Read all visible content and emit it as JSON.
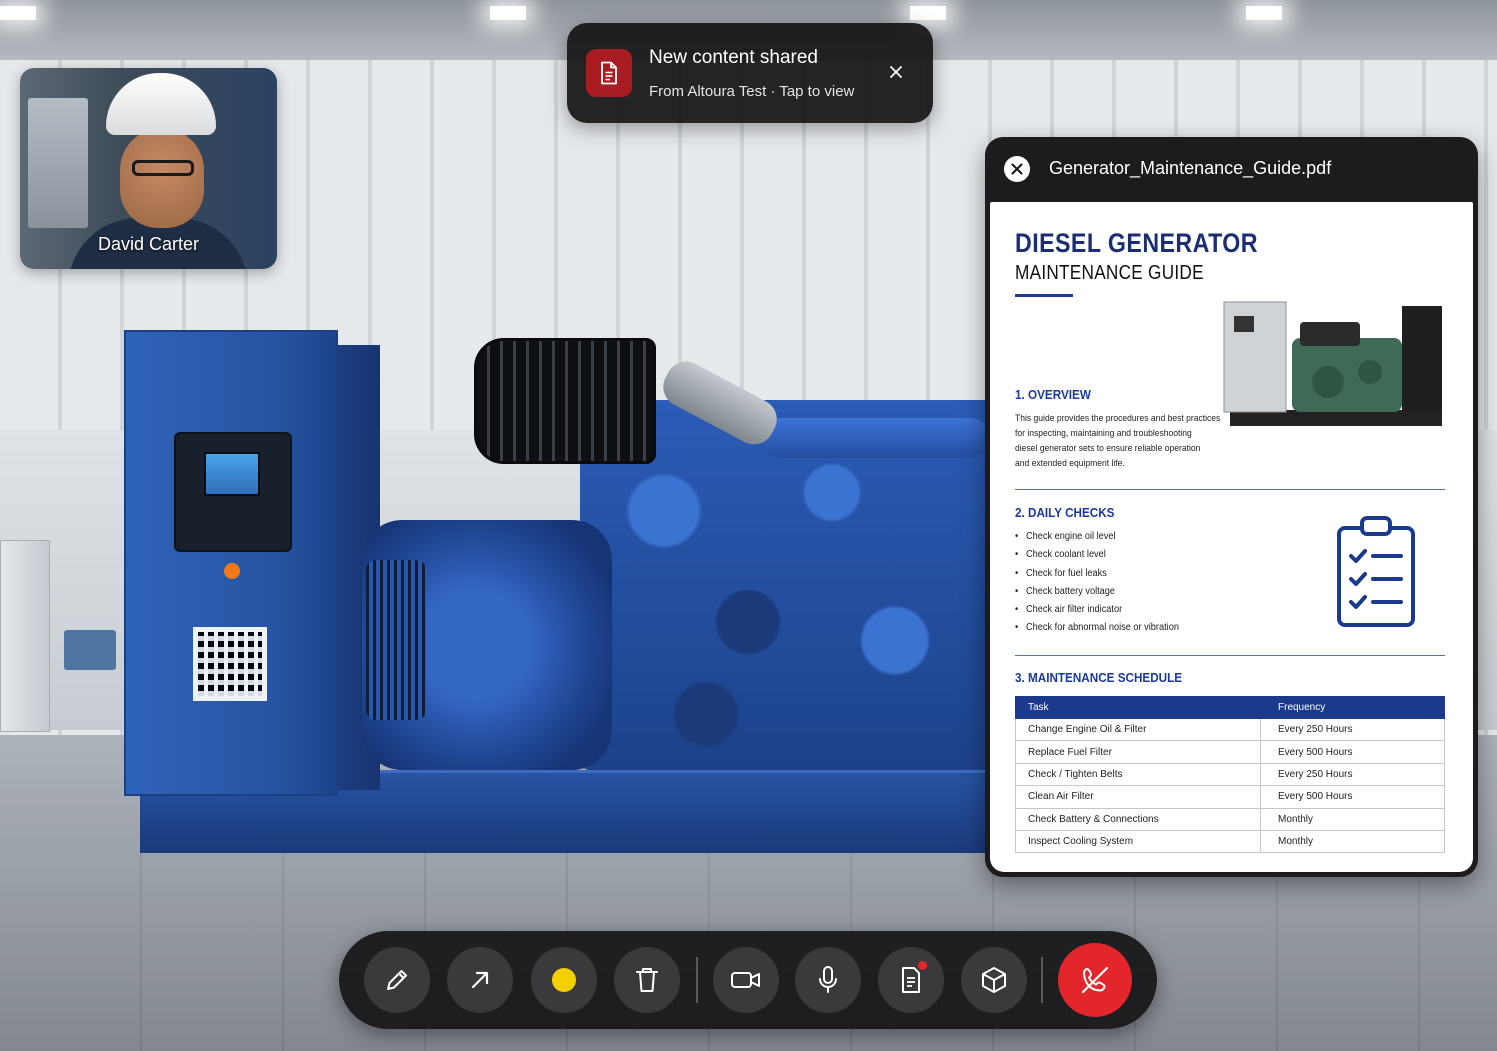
{
  "notification": {
    "title": "New content shared",
    "subtitle": "From Altoura Test · Tap to view",
    "icon": "document-icon",
    "accent": "#a81c22"
  },
  "participant": {
    "name": "David Carter"
  },
  "document_viewer": {
    "filename": "Generator_Maintenance_Guide.pdf",
    "doc": {
      "title_line1": "DIESEL GENERATOR",
      "title_line2": "MAINTENANCE GUIDE",
      "overview_heading": "1. OVERVIEW",
      "overview_text_lines": [
        "This guide provides the procedures and best practices",
        "for inspecting, maintaining and troubleshooting",
        "diesel generator sets to ensure reliable operation",
        "and extended equipment life."
      ],
      "daily_checks_heading": "2. DAILY CHECKS",
      "daily_checks": [
        "Check engine oil level",
        "Check coolant level",
        "Check for fuel leaks",
        "Check battery voltage",
        "Check air filter indicator",
        "Check for abnormal noise or vibration"
      ],
      "schedule_heading": "3. MAINTENANCE SCHEDULE",
      "schedule_columns": [
        "Task",
        "Frequency"
      ],
      "schedule_rows": [
        [
          "Change Engine Oil & Filter",
          "Every 250 Hours"
        ],
        [
          "Replace Fuel Filter",
          "Every 500 Hours"
        ],
        [
          "Check / Tighten Belts",
          "Every 250 Hours"
        ],
        [
          "Clean Air Filter",
          "Every 500 Hours"
        ],
        [
          "Check Battery & Connections",
          "Monthly"
        ],
        [
          "Inspect Cooling System",
          "Monthly"
        ]
      ],
      "accent": "#1b3a9a"
    }
  },
  "toolbar": {
    "buttons": [
      {
        "name": "pen-tool-button",
        "icon": "pencil-icon"
      },
      {
        "name": "arrow-tool-button",
        "icon": "arrow-up-right-icon"
      },
      {
        "name": "color-picker-button",
        "icon": "color-dot-icon",
        "color": "#f5d000"
      },
      {
        "name": "delete-button",
        "icon": "trash-icon"
      },
      {
        "name": "camera-button",
        "icon": "video-camera-icon"
      },
      {
        "name": "microphone-button",
        "icon": "microphone-icon"
      },
      {
        "name": "shared-content-button",
        "icon": "document-icon",
        "has_badge": true
      },
      {
        "name": "ar-object-button",
        "icon": "cube-icon"
      },
      {
        "name": "end-call-button",
        "icon": "hang-up-icon",
        "color": "#e3262b"
      }
    ]
  }
}
